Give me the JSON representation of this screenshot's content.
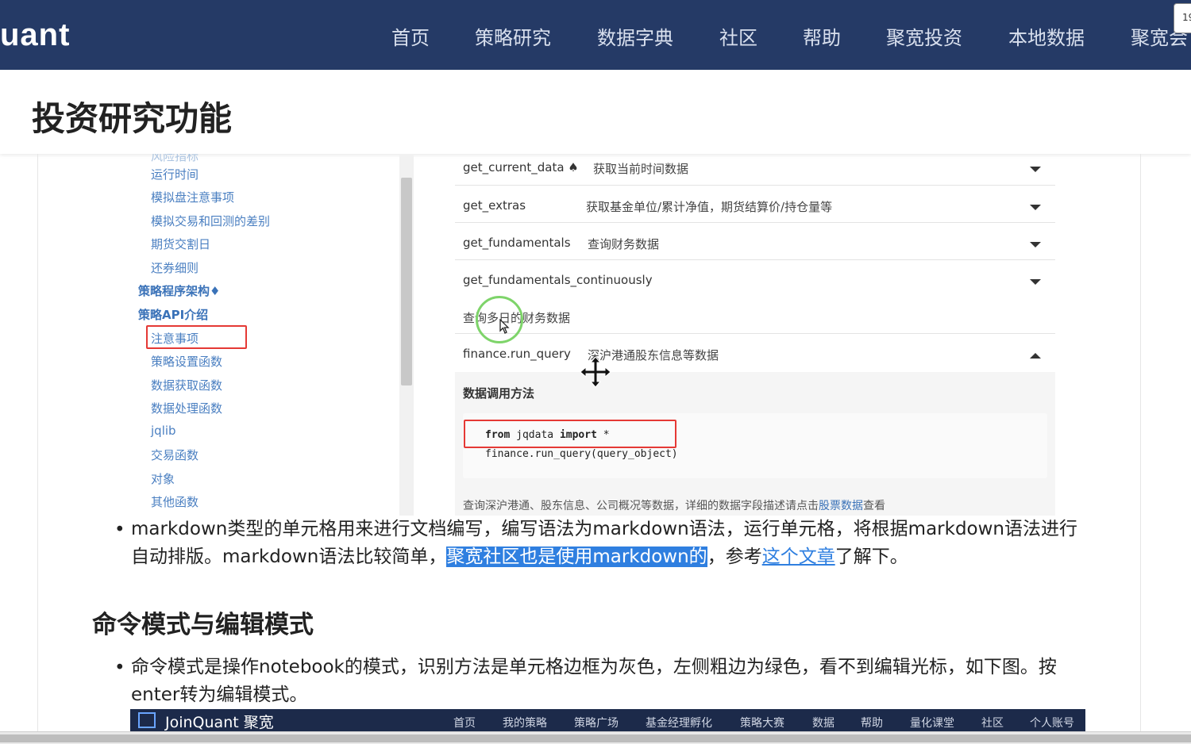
{
  "topnav": {
    "logo": "uant",
    "items": [
      "首页",
      "策略研究",
      "数据字典",
      "社区",
      "帮助",
      "聚宽投资",
      "本地数据",
      "聚宽会"
    ],
    "corner_badge": "19"
  },
  "page": {
    "title": "投资研究功能"
  },
  "sidebar": {
    "items": [
      "运行时间",
      "模拟盘注意事项",
      "模拟交易和回测的差别",
      "期货交割日",
      "还券细则"
    ],
    "section_arch": "策略程序架构♦",
    "section_api": "策略API介绍",
    "api_items": [
      "注意事项",
      "策略设置函数",
      "数据获取函数",
      "数据处理函数",
      "jqlib",
      "交易函数",
      "对象",
      "其他函数"
    ]
  },
  "api_rows": [
    {
      "name": "get_current_data ♠",
      "desc": "获取当前时间数据"
    },
    {
      "name": "get_extras",
      "desc": "获取基金单位/累计净值，期货结算价/持仓量等"
    },
    {
      "name": "get_fundamentals",
      "desc": "查询财务数据"
    },
    {
      "name": "get_fundamentals_continuously",
      "desc": "查询多日的财务数据"
    },
    {
      "name": "finance.run_query",
      "desc": "深沪港通股东信息等数据"
    }
  ],
  "detail": {
    "title": "数据调用方法",
    "code_line1_kw1": "from",
    "code_line1_mid": " jqdata ",
    "code_line1_kw2": "import",
    "code_line1_end": " *",
    "code_line2": "finance.run_query(query_object)",
    "note_prefix": "查询深沪港通、股东信息、公司概况等数据，详细的数据字段描述请点击",
    "note_link": "股票数据",
    "note_suffix": "查看"
  },
  "article": {
    "bullet": "•",
    "p1_a": "markdown类型的单元格用来进行文档编写，编写语法为markdown语法，运行单元格，将根据markdown语法进行自动排版。markdown语法比较简单，",
    "p1_highlight": "聚宽社区也是使用markdown的",
    "p1_b": "，参考",
    "p1_link": "这个文章",
    "p1_c": "了解下。",
    "h2": "命令模式与编辑模式",
    "p2": "命令模式是操作notebook的模式，识别方法是单元格边框为灰色，左侧粗边为绿色，看不到编辑光标，如下图。按enter转为编辑模式。"
  },
  "jqbar": {
    "logo": "JoinQuant 聚宽",
    "items": [
      "首页",
      "我的策略",
      "策略广场",
      "基金经理孵化",
      "策略大赛",
      "数据",
      "帮助",
      "量化课堂",
      "社区",
      "个人账号"
    ]
  }
}
